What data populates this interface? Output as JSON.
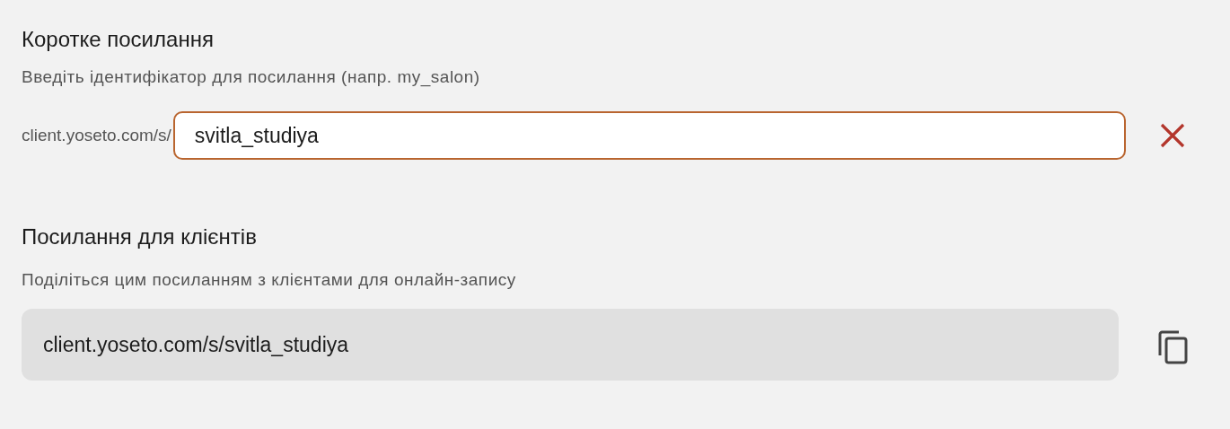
{
  "short_link": {
    "title": "Коротке посилання",
    "description": "Введіть ідентифікатор для посилання (напр. my_salon)",
    "prefix": "client.yoseto.com/s/",
    "input": {
      "value": "svitla_studiya",
      "focused": true
    }
  },
  "client_link": {
    "title": "Посилання для клієнтів",
    "description": "Поділіться цим посиланням з клієнтами для онлайн-запису",
    "url": "client.yoseto.com/s/svitla_studiya"
  }
}
